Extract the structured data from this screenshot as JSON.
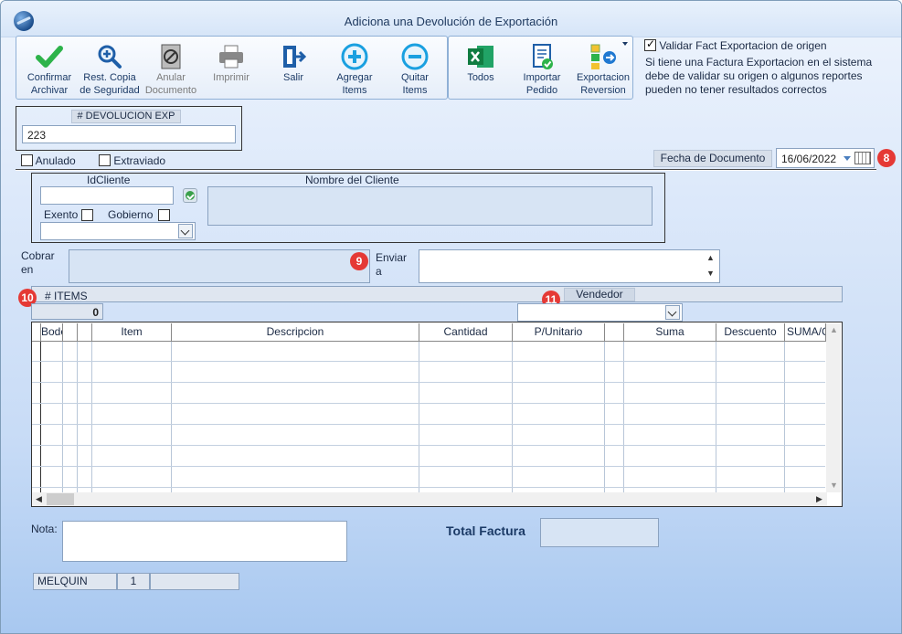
{
  "window": {
    "title": "Adiciona una Devolución de Exportación"
  },
  "toolbar": {
    "buttons": [
      {
        "label": "Confirmar\nArchivar",
        "icon": "check-icon"
      },
      {
        "label": "Rest. Copia\nde Seguridad",
        "icon": "magnify-plus-icon"
      },
      {
        "label": "Anular\nDocumento",
        "icon": "void-document-icon"
      },
      {
        "label": "Imprimir",
        "icon": "printer-icon"
      },
      {
        "label": "Salir",
        "icon": "exit-door-icon"
      },
      {
        "label": "Agregar\nItems",
        "icon": "plus-circle-icon"
      },
      {
        "label": "Quitar\nItems",
        "icon": "minus-circle-icon"
      }
    ],
    "export_buttons": [
      {
        "label": "Todos",
        "icon": "excel-icon"
      },
      {
        "label": "Importar\nPedido",
        "icon": "import-doc-icon"
      },
      {
        "label": "Exportacion\nReversion",
        "icon": "export-flow-icon"
      }
    ]
  },
  "validation": {
    "checkbox_label": "Validar Fact Exportacion de origen",
    "checked": true,
    "note": "Si tiene una Factura Exportacion en el sistema debe de validar su origen o algunos reportes pueden no tener resultados correctos"
  },
  "devolucion": {
    "label": "# DEVOLUCION EXP",
    "value": "223"
  },
  "flags": {
    "anulado": "Anulado",
    "extraviado": "Extraviado"
  },
  "fecha": {
    "label": "Fecha de  Documento",
    "value": "16/06/2022"
  },
  "cliente": {
    "id_label": "IdCliente",
    "nombre_label": "Nombre del Cliente",
    "exento_label": "Exento",
    "gobierno_label": "Gobierno"
  },
  "cobrar": {
    "label": "Cobrar\nen"
  },
  "enviar": {
    "label": "Enviar\na"
  },
  "items": {
    "label": "# ITEMS",
    "count": "0",
    "vendedor_label": "Vendedor"
  },
  "grid": {
    "columns": [
      "",
      "Bodega",
      "",
      "",
      "Item",
      "Descripcion",
      "Cantidad",
      "P/Unitario",
      "",
      "Suma",
      "Descuento",
      "SUMA/C"
    ]
  },
  "footer": {
    "nota_label": "Nota:",
    "total_label": "Total Factura"
  },
  "status": {
    "user": "MELQUIN",
    "num": "1",
    "extra": ""
  },
  "badges": [
    "8",
    "9",
    "10",
    "11"
  ],
  "colors": {
    "badge": "#e53935",
    "accent": "#1b3a66"
  }
}
